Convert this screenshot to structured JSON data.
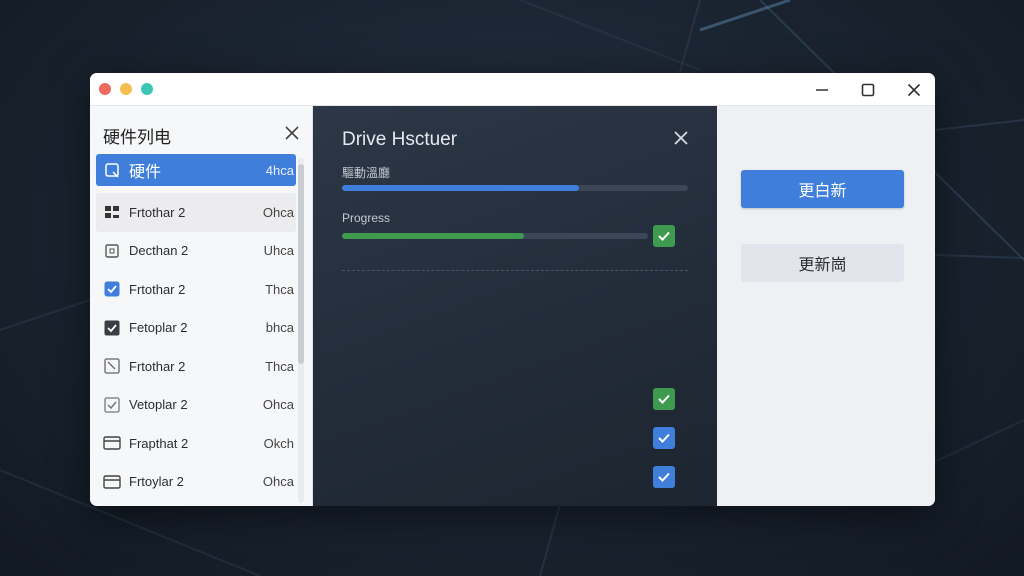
{
  "sidebar": {
    "title": "硬件列电",
    "items": [
      {
        "label": "硬件",
        "value": "4hca",
        "icon": "device-icon",
        "selected": true
      },
      {
        "label": "Frtothar 2",
        "value": "Ohca",
        "icon": "grid-icon"
      },
      {
        "label": "Decthan 2",
        "value": "Uhca",
        "icon": "square-icon"
      },
      {
        "label": "Frtothar 2",
        "value": "Thca",
        "icon": "checkbox-checked-icon"
      },
      {
        "label": "Fetoplar 2",
        "value": "bhca",
        "icon": "checkbox-dark-icon"
      },
      {
        "label": "Frtothar 2",
        "value": "Thca",
        "icon": "resize-icon"
      },
      {
        "label": "Vetoplar 2",
        "value": "Ohca",
        "icon": "check-outline-icon"
      },
      {
        "label": "Frapthat 2",
        "value": "Okch",
        "icon": "window-icon"
      },
      {
        "label": "Frtoylar 2",
        "value": "Ohca",
        "icon": "window-icon"
      }
    ]
  },
  "panel": {
    "title": "Drive Hsctuer",
    "bar1_label": "驅動溫廳",
    "bar1_progress": 0.685,
    "bar2_label": "Progress",
    "bar2_progress": 0.595
  },
  "actions": {
    "primary_label": "更白新",
    "secondary_label": "更新崗"
  },
  "colors": {
    "accent": "#3f7fdb",
    "success": "#3e9a4e",
    "panel_bg": "#222b38"
  }
}
